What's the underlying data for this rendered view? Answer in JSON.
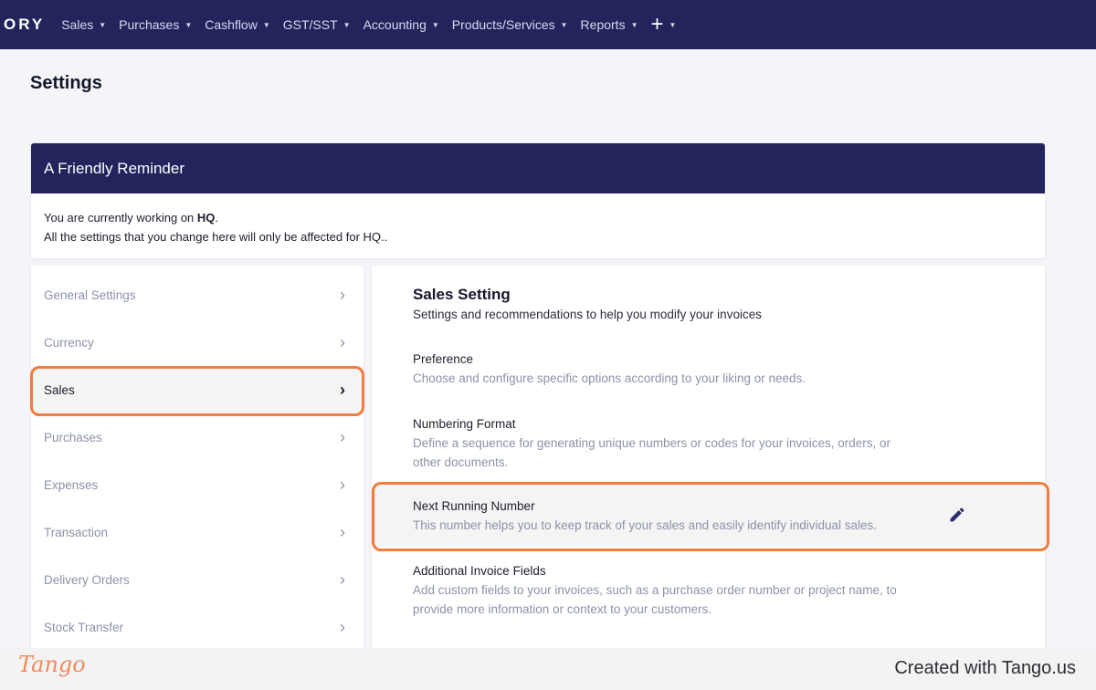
{
  "nav": {
    "brand": "ORY",
    "items": [
      {
        "label": "Sales"
      },
      {
        "label": "Purchases"
      },
      {
        "label": "Cashflow"
      },
      {
        "label": "GST/SST"
      },
      {
        "label": "Accounting"
      },
      {
        "label": "Products/Services"
      },
      {
        "label": "Reports"
      }
    ],
    "plus": "+"
  },
  "page": {
    "title": "Settings"
  },
  "reminder": {
    "title": "A Friendly Reminder",
    "line1_prefix": "You are currently working on ",
    "line1_branch": "HQ",
    "line1_suffix": ".",
    "line2": "All the settings that you change here will only be affected for HQ.."
  },
  "sidebar": {
    "items": [
      {
        "label": "General Settings"
      },
      {
        "label": "Currency"
      },
      {
        "label": "Sales"
      },
      {
        "label": "Purchases"
      },
      {
        "label": "Expenses"
      },
      {
        "label": "Transaction"
      },
      {
        "label": "Delivery Orders"
      },
      {
        "label": "Stock Transfer"
      }
    ]
  },
  "main": {
    "title": "Sales Setting",
    "subtitle": "Settings and recommendations to help you modify your invoices",
    "options": [
      {
        "title": "Preference",
        "desc": "Choose and configure specific options according to your liking or needs."
      },
      {
        "title": "Numbering Format",
        "desc": "Define a sequence for generating unique numbers or codes for your invoices, orders, or other documents."
      },
      {
        "title": "Next Running Number",
        "desc": "This number helps you to keep track of your sales and easily identify individual sales."
      },
      {
        "title": "Additional Invoice Fields",
        "desc": "Add custom fields to your invoices, such as a purchase order number or project name, to provide more information or context to your customers."
      }
    ]
  },
  "footer": {
    "logo": "Tango",
    "credit": "Created with Tango.us"
  },
  "colors": {
    "nav_bg": "#23245c",
    "highlight": "#f47b3c",
    "muted_text": "#8a93a8"
  },
  "icons": {
    "chevron": "chevron-right-icon",
    "caret": "caret-down-icon",
    "edit": "pencil-icon"
  }
}
